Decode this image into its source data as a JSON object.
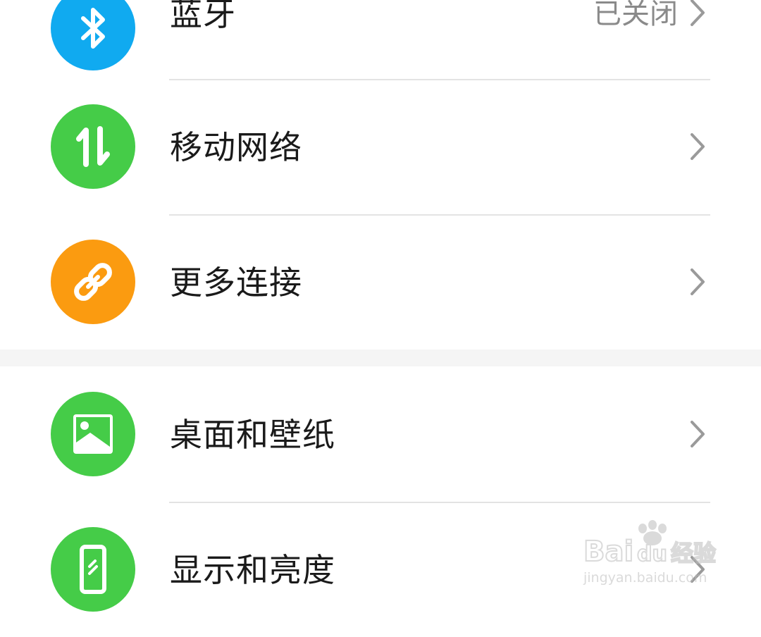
{
  "settings": {
    "group1": [
      {
        "label": "蓝牙",
        "value": "已关闭",
        "icon": "bluetooth-icon",
        "color": "#10aaf0"
      },
      {
        "label": "移动网络",
        "value": "",
        "icon": "mobile-data-icon",
        "color": "#45cc48"
      },
      {
        "label": "更多连接",
        "value": "",
        "icon": "link-icon",
        "color": "#fb9b10"
      }
    ],
    "group2": [
      {
        "label": "桌面和壁纸",
        "value": "",
        "icon": "wallpaper-icon",
        "color": "#45cc48"
      },
      {
        "label": "显示和亮度",
        "value": "",
        "icon": "display-icon",
        "color": "#45cc48"
      }
    ]
  },
  "watermark": {
    "brand_latin_1": "Bai",
    "brand_latin_2": "du",
    "brand_cn": "经验",
    "url": "jingyan.baidu.com"
  }
}
